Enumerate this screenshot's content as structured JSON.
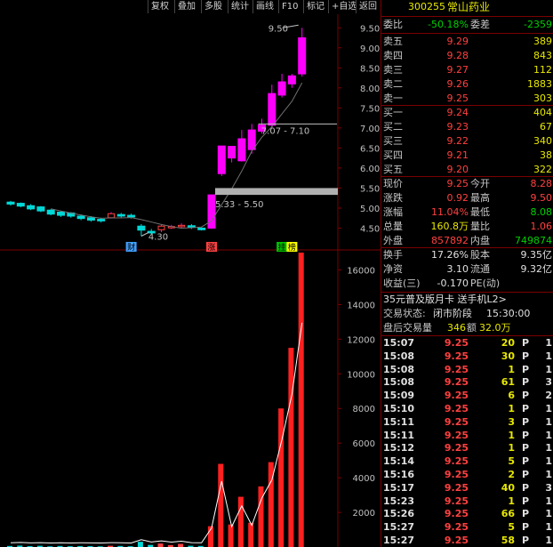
{
  "toolbar": {
    "buttons": [
      "复权",
      "叠加",
      "多股",
      "统计",
      "画线",
      "F10",
      "标记",
      "+自选",
      "返回"
    ]
  },
  "colors": {
    "up": "#ff00ff",
    "down": "#00d8d8",
    "ma": "#ffffff",
    "bg": "#000000",
    "grid": "#7a0000"
  },
  "chart_data": [
    {
      "type": "candlestick",
      "y_ticks": [
        "9.50",
        "9.00",
        "8.50",
        "8.00",
        "7.50",
        "7.00",
        "6.50",
        "6.00",
        "5.50",
        "5.00",
        "4.50"
      ],
      "ylim": [
        4.2,
        9.75
      ],
      "candles": [
        {
          "o": 5.15,
          "h": 5.18,
          "c": 5.1,
          "l": 5.06
        },
        {
          "o": 5.12,
          "h": 5.14,
          "c": 5.05,
          "l": 5.02
        },
        {
          "o": 5.06,
          "h": 5.1,
          "c": 4.98,
          "l": 4.95
        },
        {
          "o": 5.03,
          "h": 5.05,
          "c": 4.93,
          "l": 4.9
        },
        {
          "o": 4.95,
          "h": 4.97,
          "c": 4.85,
          "l": 4.82
        },
        {
          "o": 4.9,
          "h": 4.92,
          "c": 4.82,
          "l": 4.78
        },
        {
          "o": 4.88,
          "h": 4.9,
          "c": 4.8,
          "l": 4.76
        },
        {
          "o": 4.8,
          "h": 4.84,
          "c": 4.74,
          "l": 4.7
        },
        {
          "o": 4.76,
          "h": 4.8,
          "c": 4.7,
          "l": 4.66
        },
        {
          "o": 4.72,
          "h": 4.76,
          "c": 4.68,
          "l": 4.64
        },
        {
          "o": 4.76,
          "h": 4.9,
          "c": 4.86,
          "l": 4.74
        },
        {
          "o": 4.84,
          "h": 4.88,
          "c": 4.8,
          "l": 4.76
        },
        {
          "o": 4.82,
          "h": 4.86,
          "c": 4.78,
          "l": 4.74
        },
        {
          "o": 4.55,
          "h": 4.6,
          "c": 4.45,
          "l": 4.3
        },
        {
          "o": 4.42,
          "h": 4.48,
          "c": 4.38,
          "l": 4.35
        },
        {
          "o": 4.46,
          "h": 4.58,
          "c": 4.55,
          "l": 4.4
        },
        {
          "o": 4.52,
          "h": 4.58,
          "c": 4.54,
          "l": 4.48
        },
        {
          "o": 4.55,
          "h": 4.62,
          "c": 4.57,
          "l": 4.5
        },
        {
          "o": 4.56,
          "h": 4.6,
          "c": 4.52,
          "l": 4.48
        },
        {
          "o": 4.5,
          "h": 4.52,
          "c": 4.46,
          "l": 4.44
        },
        {
          "o": 4.5,
          "h": 5.33,
          "c": 5.33,
          "l": 4.48
        },
        {
          "o": 5.86,
          "h": 6.55,
          "c": 6.55,
          "l": 5.8
        },
        {
          "o": 6.25,
          "h": 6.54,
          "c": 6.54,
          "l": 6.14
        },
        {
          "o": 6.18,
          "h": 6.95,
          "c": 6.73,
          "l": 6.16
        },
        {
          "o": 6.46,
          "h": 7.1,
          "c": 6.95,
          "l": 6.36
        },
        {
          "o": 6.92,
          "h": 7.23,
          "c": 7.07,
          "l": 6.86
        },
        {
          "o": 7.07,
          "h": 8.08,
          "c": 7.86,
          "l": 7.0
        },
        {
          "o": 7.82,
          "h": 8.35,
          "c": 8.15,
          "l": 7.76
        },
        {
          "o": 8.1,
          "h": 8.35,
          "c": 8.3,
          "l": 8.0
        },
        {
          "o": 8.35,
          "h": 9.5,
          "c": 9.25,
          "l": 8.28
        }
      ],
      "annotations": [
        {
          "label": "9.50"
        },
        {
          "label": "7.07 - 7.10"
        },
        {
          "label": "5.33 - 5.50"
        },
        {
          "label": "4.30"
        }
      ],
      "markers": [
        "财",
        "涨",
        "挂",
        "榜"
      ]
    },
    {
      "type": "bar",
      "y_ticks": [
        "16000",
        "14000",
        "12000",
        "10000",
        "8000",
        "6000",
        "4000",
        "2000"
      ],
      "ylim": [
        0,
        17000
      ],
      "volumes": [
        60,
        80,
        50,
        70,
        40,
        60,
        45,
        55,
        50,
        40,
        70,
        60,
        45,
        300,
        120,
        200,
        110,
        180,
        70,
        60,
        1200,
        4800,
        1300,
        2900,
        1400,
        3500,
        4900,
        8000,
        11500,
        17000
      ]
    }
  ],
  "quote": {
    "code": "300255",
    "name": "常山药业",
    "weibi_label": "委比",
    "weibi": "-50.18%",
    "weicha_label": "委差",
    "weicha": "-2359",
    "asks": [
      {
        "label": "卖五",
        "price": "9.29",
        "vol": "389"
      },
      {
        "label": "卖四",
        "price": "9.28",
        "vol": "843"
      },
      {
        "label": "卖三",
        "price": "9.27",
        "vol": "112"
      },
      {
        "label": "卖二",
        "price": "9.26",
        "vol": "1883"
      },
      {
        "label": "卖一",
        "price": "9.25",
        "vol": "303"
      }
    ],
    "bids": [
      {
        "label": "买一",
        "price": "9.24",
        "vol": "404"
      },
      {
        "label": "买二",
        "price": "9.23",
        "vol": "67"
      },
      {
        "label": "买三",
        "price": "9.22",
        "vol": "340"
      },
      {
        "label": "买四",
        "price": "9.21",
        "vol": "38"
      },
      {
        "label": "买五",
        "price": "9.20",
        "vol": "322"
      }
    ],
    "stats": [
      {
        "l1": "现价",
        "v1": "9.25",
        "l2": "今开",
        "v2": "8.28"
      },
      {
        "l1": "涨跌",
        "v1": "0.92",
        "l2": "最高",
        "v2": "9.50"
      },
      {
        "l1": "涨幅",
        "v1": "11.04%",
        "l2": "最低",
        "v2": "8.08"
      },
      {
        "l1": "总量",
        "v1": "160.8万",
        "l2": "量比",
        "v2": "1.06"
      },
      {
        "l1": "外盘",
        "v1": "857892",
        "l2": "内盘",
        "v2": "749874"
      }
    ],
    "fund": [
      {
        "l1": "换手",
        "v1": "17.26%",
        "l2": "股本",
        "v2": "9.35亿"
      },
      {
        "l1": "净资",
        "v1": "3.10",
        "l2": "流通",
        "v2": "9.32亿"
      },
      {
        "l1": "收益(三)",
        "v1": "-0.170",
        "l2": "PE(动)",
        "v2": ""
      }
    ],
    "promo": "35元普及版月卡 送手机L2>",
    "trade_state_label": "交易状态:",
    "trade_state": "闭市阶段",
    "trade_time": "15:30:00",
    "after_label": "盘后交易量",
    "after_vol": "346",
    "amount_label": "额",
    "amount": "32.0万",
    "ticks": [
      {
        "t": "15:07",
        "p": "9.25",
        "v": "20",
        "f": "P",
        "n": "1"
      },
      {
        "t": "15:08",
        "p": "9.25",
        "v": "30",
        "f": "P",
        "n": "1"
      },
      {
        "t": "15:08",
        "p": "9.25",
        "v": "1",
        "f": "P",
        "n": "1"
      },
      {
        "t": "15:08",
        "p": "9.25",
        "v": "61",
        "f": "P",
        "n": "3"
      },
      {
        "t": "15:09",
        "p": "9.25",
        "v": "6",
        "f": "P",
        "n": "2"
      },
      {
        "t": "15:10",
        "p": "9.25",
        "v": "1",
        "f": "P",
        "n": "1"
      },
      {
        "t": "15:11",
        "p": "9.25",
        "v": "3",
        "f": "P",
        "n": "1"
      },
      {
        "t": "15:11",
        "p": "9.25",
        "v": "1",
        "f": "P",
        "n": "1"
      },
      {
        "t": "15:12",
        "p": "9.25",
        "v": "1",
        "f": "P",
        "n": "1"
      },
      {
        "t": "15:14",
        "p": "9.25",
        "v": "5",
        "f": "P",
        "n": "1"
      },
      {
        "t": "15:16",
        "p": "9.25",
        "v": "2",
        "f": "P",
        "n": "1"
      },
      {
        "t": "15:17",
        "p": "9.25",
        "v": "40",
        "f": "P",
        "n": "3"
      },
      {
        "t": "15:23",
        "p": "9.25",
        "v": "1",
        "f": "P",
        "n": "1"
      },
      {
        "t": "15:26",
        "p": "9.25",
        "v": "66",
        "f": "P",
        "n": "1"
      },
      {
        "t": "15:27",
        "p": "9.25",
        "v": "5",
        "f": "P",
        "n": "1"
      },
      {
        "t": "15:27",
        "p": "9.25",
        "v": "58",
        "f": "P",
        "n": "1"
      }
    ]
  }
}
